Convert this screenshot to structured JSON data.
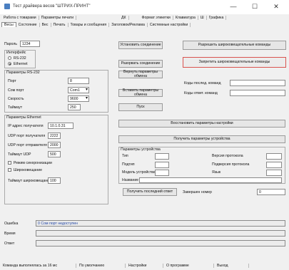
{
  "window": {
    "title": "Тест драйвера весов \"ШТРИХ-ПРИНТ\"",
    "minimize": "—",
    "maximize": "☐",
    "close": "✕"
  },
  "menu": [
    "Работа с товарами",
    "Параметры печати",
    "ДК",
    "Формат этикетки",
    "Клавиатура",
    "Ш",
    "Графика"
  ],
  "tabs": [
    "Весы",
    "Состояние",
    "Вес",
    "Печать",
    "Товары и сообщения",
    "Заголовок/Реклама",
    "Системные настройки"
  ],
  "left": {
    "pass_label": "Пароль",
    "pass_value": "1234",
    "iface_label": "Интерфейс",
    "iface_opts": [
      "RS-232",
      "Ethernet"
    ],
    "rs_label": "Параметры RS-232",
    "port_label": "Порт",
    "port_value": "8",
    "com_label": "Сом порт",
    "com_value": "Com1",
    "speed_label": "Скорость",
    "speed_value": "9600",
    "timeout_label": "Таймаут",
    "timeout_value": "250",
    "eth_label": "Параметры Ethernet",
    "ip_label": "IP адрес получателя",
    "ip_value": "10.1.0.31",
    "udp_recv_label": "UDP порт получателя",
    "udp_recv_value": "2222",
    "udp_send_label": "UDP порт отправителя",
    "udp_send_value": "2000",
    "udp_to_label": "Таймаут UDP",
    "udp_to_value": "500",
    "check1": "Режим синхронизации",
    "check2": "Широковещание",
    "bcast_to_label": "Таймаут широковещания",
    "bcast_to_value": "100"
  },
  "right": {
    "btn_connect": "Установить соединение",
    "btn_disconnect": "Разорвать соединение",
    "btn_restore_params": "Вернуть параметры обмена",
    "btn_get_params": "Вставить параметры обмена",
    "btn_help": "Пуск",
    "btn_allow_bcast": "Разрешить широковещательные команды",
    "btn_forbid_bcast": "Запретить широковещательные команды",
    "cmd_label1": "Коды послед. команд",
    "cmd_label2": "Коды ответ. команд",
    "btn_restore_settings": "Восстановить параметры настройки",
    "btn_get_device": "Получить параметры устройства",
    "dev_group": "Параметры устройства",
    "dev_type": "Тип",
    "dev_subtype": "Подтип",
    "dev_model": "Модель устройства",
    "dev_name": "Название",
    "proto_ver": "Версия протокола",
    "proto_sub": "Подверсия протокола",
    "lang": "Язык",
    "btn_get_last": "Получить последний ответ",
    "last_cmd_label": "Завершен номер",
    "last_cmd_value": "0"
  },
  "bottom": {
    "err_label": "Ошибка",
    "err_value": "0 Сом порт недоступен",
    "time_label": "Время",
    "time_value": "",
    "answer_label": "Ответ",
    "answer_value": ""
  },
  "status": [
    "Команда выполнялась за 16 мс",
    "По умолчанию",
    "Настройки",
    "О программе",
    "Выход"
  ]
}
